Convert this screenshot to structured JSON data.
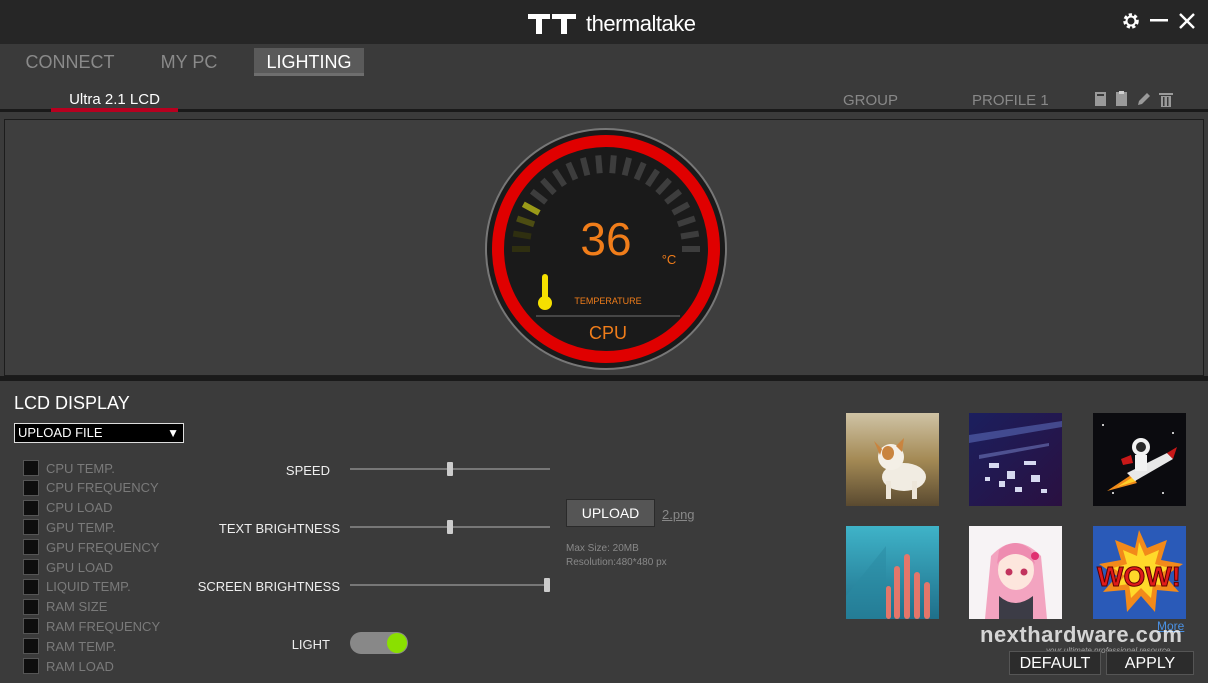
{
  "titlebar": {
    "brand": "thermaltake"
  },
  "nav": {
    "tabs": [
      {
        "label": "CONNECT"
      },
      {
        "label": "MY PC"
      },
      {
        "label": "LIGHTING"
      }
    ]
  },
  "subbar": {
    "device": "Ultra 2.1 LCD",
    "group": "GROUP",
    "profile": "PROFILE 1"
  },
  "gauge": {
    "value": "36",
    "unit": "°C",
    "label": "TEMPERATURE",
    "source": "CPU",
    "ring_color": "#e00000",
    "value_color": "#f07d1a",
    "level": 0.2
  },
  "lcd": {
    "title": "LCD DISPLAY",
    "mode": "UPLOAD FILE",
    "options": [
      "CPU TEMP.",
      "CPU FREQUENCY",
      "CPU LOAD",
      "GPU TEMP.",
      "GPU FREQUENCY",
      "GPU LOAD",
      "LIQUID TEMP.",
      "RAM SIZE",
      "RAM FREQUENCY",
      "RAM TEMP.",
      "RAM LOAD"
    ],
    "sliders": [
      {
        "label": "SPEED",
        "value": 0.5
      },
      {
        "label": "TEXT BRIGHTNESS",
        "value": 0.5
      },
      {
        "label": "SCREEN BRIGHTNESS",
        "value": 1.0
      }
    ],
    "light_label": "LIGHT",
    "light_on": true,
    "upload_label": "UPLOAD",
    "file_name": "2.png",
    "max_size": "Max Size: 20MB",
    "resolution": "Resolution:480*480 px",
    "more_label": "More",
    "default_label": "DEFAULT",
    "apply_label": "APPLY"
  },
  "watermark": {
    "main": "nexthardware.com",
    "sub": "your ultimate professional resource"
  }
}
